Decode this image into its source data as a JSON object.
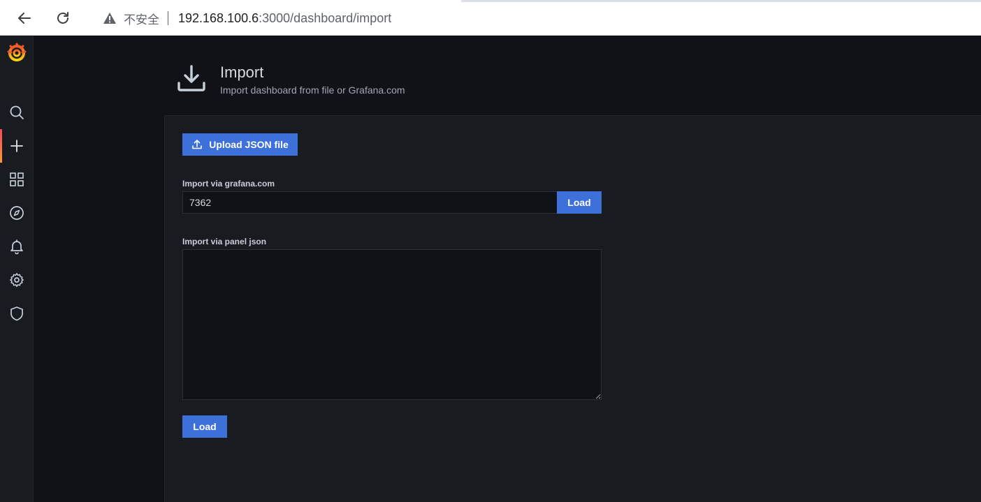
{
  "browser": {
    "security_label": "不安全",
    "url_host": "192.168.100.6",
    "url_rest": ":3000/dashboard/import"
  },
  "sidemenu": {
    "items": [
      {
        "icon": "search-icon"
      },
      {
        "icon": "plus-icon",
        "active": true
      },
      {
        "icon": "dashboards-grid-icon"
      },
      {
        "icon": "explore-compass-icon"
      },
      {
        "icon": "alerting-bell-icon"
      },
      {
        "icon": "configuration-gear-icon"
      },
      {
        "icon": "server-admin-shield-icon"
      }
    ]
  },
  "header": {
    "title": "Import",
    "subtitle": "Import dashboard from file or Grafana.com"
  },
  "form": {
    "upload_label": "Upload JSON file",
    "grafana_label": "Import via grafana.com",
    "grafana_value": "7362",
    "load_label": "Load",
    "json_label": "Import via panel json",
    "json_value": "",
    "load_bottom_label": "Load"
  },
  "colors": {
    "primary": "#3d71d9",
    "background": "#111217",
    "panel": "#181b1f",
    "grafana_orange": "#f46800"
  }
}
